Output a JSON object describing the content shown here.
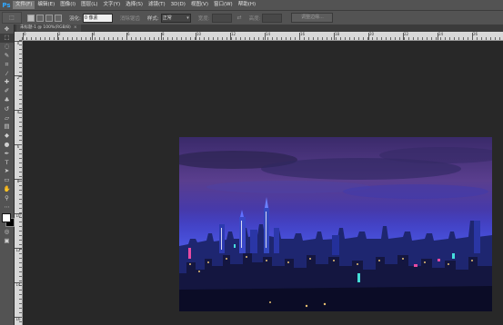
{
  "app": {
    "logo": "Ps"
  },
  "menu": [
    "文件(F)",
    "编辑(E)",
    "图像(I)",
    "图层(L)",
    "文字(Y)",
    "选择(S)",
    "滤镜(T)",
    "3D(D)",
    "视图(V)",
    "窗口(W)",
    "帮助(H)"
  ],
  "options": {
    "feather_label": "羽化:",
    "feather_value": "0 像素",
    "antialias_label": "消除锯齿",
    "style_label": "样式:",
    "style_value": "正常",
    "width_label": "宽度:",
    "height_label": "高度:",
    "refine_label": "调整边缘..."
  },
  "document": {
    "tab_label": "未标题-1 @ 100%(RGB/8)",
    "close": "×"
  },
  "ruler": {
    "h_ticks": [
      "0",
      "2",
      "4",
      "6",
      "8",
      "10",
      "12",
      "14",
      "16",
      "18",
      "20",
      "22",
      "24",
      "26"
    ],
    "v_ticks": [
      "0",
      "2",
      "4",
      "6",
      "8",
      "10",
      "12",
      "14",
      "16"
    ]
  },
  "tools": [
    "move-icon",
    "marquee-icon",
    "lasso-icon",
    "quick-select-icon",
    "crop-icon",
    "eyedropper-icon",
    "healing-icon",
    "brush-icon",
    "stamp-icon",
    "history-brush-icon",
    "eraser-icon",
    "gradient-icon",
    "blur-icon",
    "dodge-icon",
    "pen-icon",
    "type-icon",
    "path-select-icon",
    "shape-icon",
    "hand-icon",
    "zoom-icon"
  ],
  "colors": {
    "foreground": "#ffffff",
    "background": "#000000",
    "accent": "#31a8ff"
  }
}
